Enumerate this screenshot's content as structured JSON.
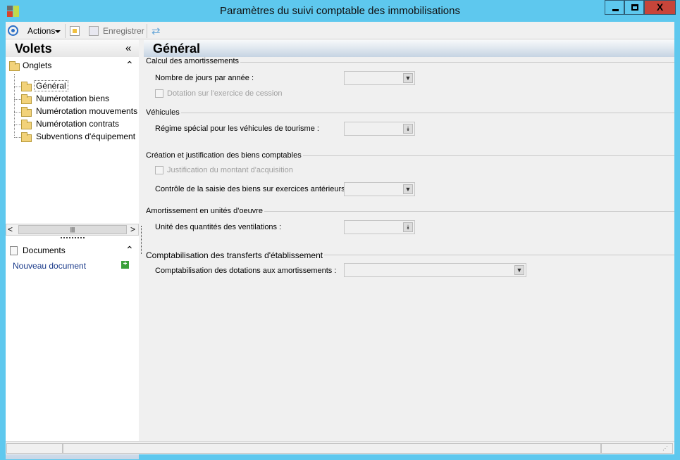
{
  "window": {
    "title": "Paramètres du suivi comptable des immobilisations"
  },
  "toolbar": {
    "actions_label": "Actions",
    "save_label": "Enregistrer"
  },
  "left_pane": {
    "title": "Volets",
    "collapse_glyph": "«",
    "onglets": {
      "label": "Onglets",
      "items": [
        {
          "label": "Général",
          "selected": true
        },
        {
          "label": "Numérotation biens"
        },
        {
          "label": "Numérotation mouvements"
        },
        {
          "label": "Numérotation contrats"
        },
        {
          "label": "Subventions d'équipement"
        }
      ]
    },
    "documents": {
      "label": "Documents",
      "new_document": "Nouveau document"
    }
  },
  "main": {
    "title": "Général",
    "groups": {
      "calcul": {
        "title": "Calcul des amortissements",
        "jours_label": "Nombre de jours par année :",
        "dotation_label": "Dotation sur l'exercice de cession"
      },
      "vehicules": {
        "title": "Véhicules",
        "regime_label": "Régime spécial pour les véhicules de tourisme :"
      },
      "creation": {
        "title": "Création et justification des biens comptables",
        "justification_label": "Justification du montant d'acquisition",
        "controle_label": "Contrôle de la saisie des biens sur exercices antérieurs :"
      },
      "unites": {
        "title": "Amortissement en unités d'oeuvre",
        "quantites_label": "Unité des quantités des ventilations :"
      },
      "transferts": {
        "title": "Comptabilisation des transferts d'établissement",
        "dotations_label": "Comptabilisation des dotations aux amortissements :"
      }
    }
  },
  "icons": {
    "app": "app-icon",
    "actions": "target-icon",
    "new": "new-document-icon",
    "save": "save-icon",
    "refresh": "refresh-icon",
    "folder": "folder-icon",
    "add": "plus-icon"
  },
  "colors": {
    "titlebar": "#5ec8ee",
    "close_button": "#c7453a",
    "header_gradient_end": "#c6d4e3"
  }
}
